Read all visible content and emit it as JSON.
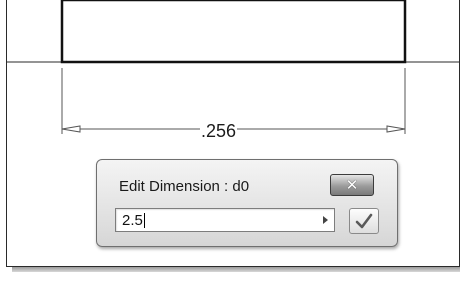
{
  "sketch": {
    "dimension_text": ".256"
  },
  "dialog": {
    "title": "Edit Dimension : d0",
    "value": "2.5",
    "close_icon": "close-icon",
    "flyout_icon": "arrow-right-icon",
    "accept_icon": "checkmark-icon"
  },
  "colors": {
    "sketch_line": "#1a1a1a",
    "dimension_line": "#555555",
    "dialog_bg": "#e4e4e4",
    "close_button": "#8a8a8a"
  }
}
